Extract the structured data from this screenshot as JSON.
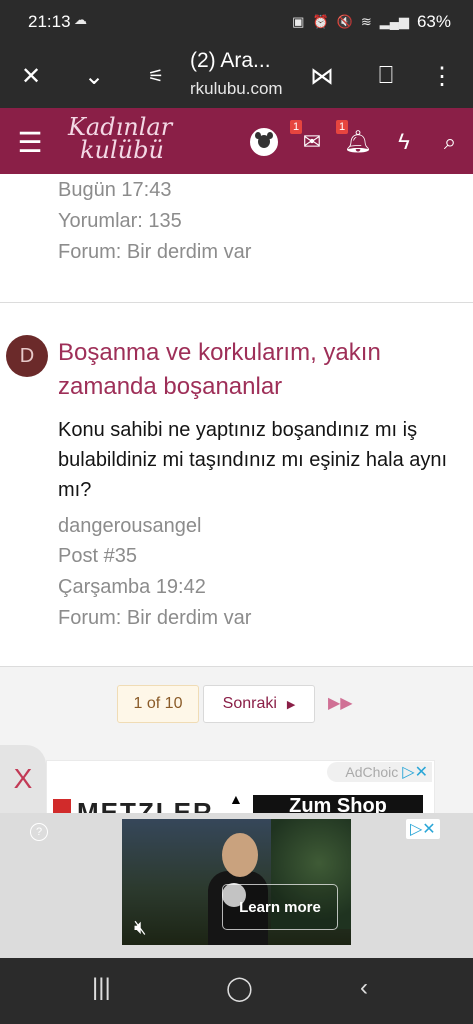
{
  "status_bar": {
    "time": "21:13",
    "battery": "63%"
  },
  "browser": {
    "tab_title": "(2) Ara...",
    "url": "rkulubu.com"
  },
  "site": {
    "logo_line1": "Kadınlar",
    "logo_line2": "kulübü",
    "messages_badge": "1",
    "alerts_badge": "1"
  },
  "previous_result": {
    "date": "Bugün 17:43",
    "comments": "Yorumlar: 135",
    "forum": "Forum: Bir derdim var"
  },
  "result": {
    "avatar_letter": "D",
    "title": "Boşanma ve korkularım, yakın zamanda boşananlar",
    "snippet": "Konu sahibi ne yaptınız boşandınız mı iş bulabildiniz mi taşındınız mı eşiniz hala aynı mı?",
    "author": "dangerousangel",
    "post": "Post #35",
    "date": "Çarşamba 19:42",
    "forum": "Forum: Bir derdim var"
  },
  "pagination": {
    "current": "1 of 10",
    "next": "Sonraki"
  },
  "close_tab": {
    "label": "X"
  },
  "ad1": {
    "adchoices": "AdChoic",
    "brand": "METZLER",
    "cta": "Zum Shop"
  },
  "ad2": {
    "help": "?",
    "learn_more": "Learn more"
  },
  "colors": {
    "header": "#8a1f47",
    "link": "#9e2f58",
    "meta": "#8c8c8c"
  }
}
